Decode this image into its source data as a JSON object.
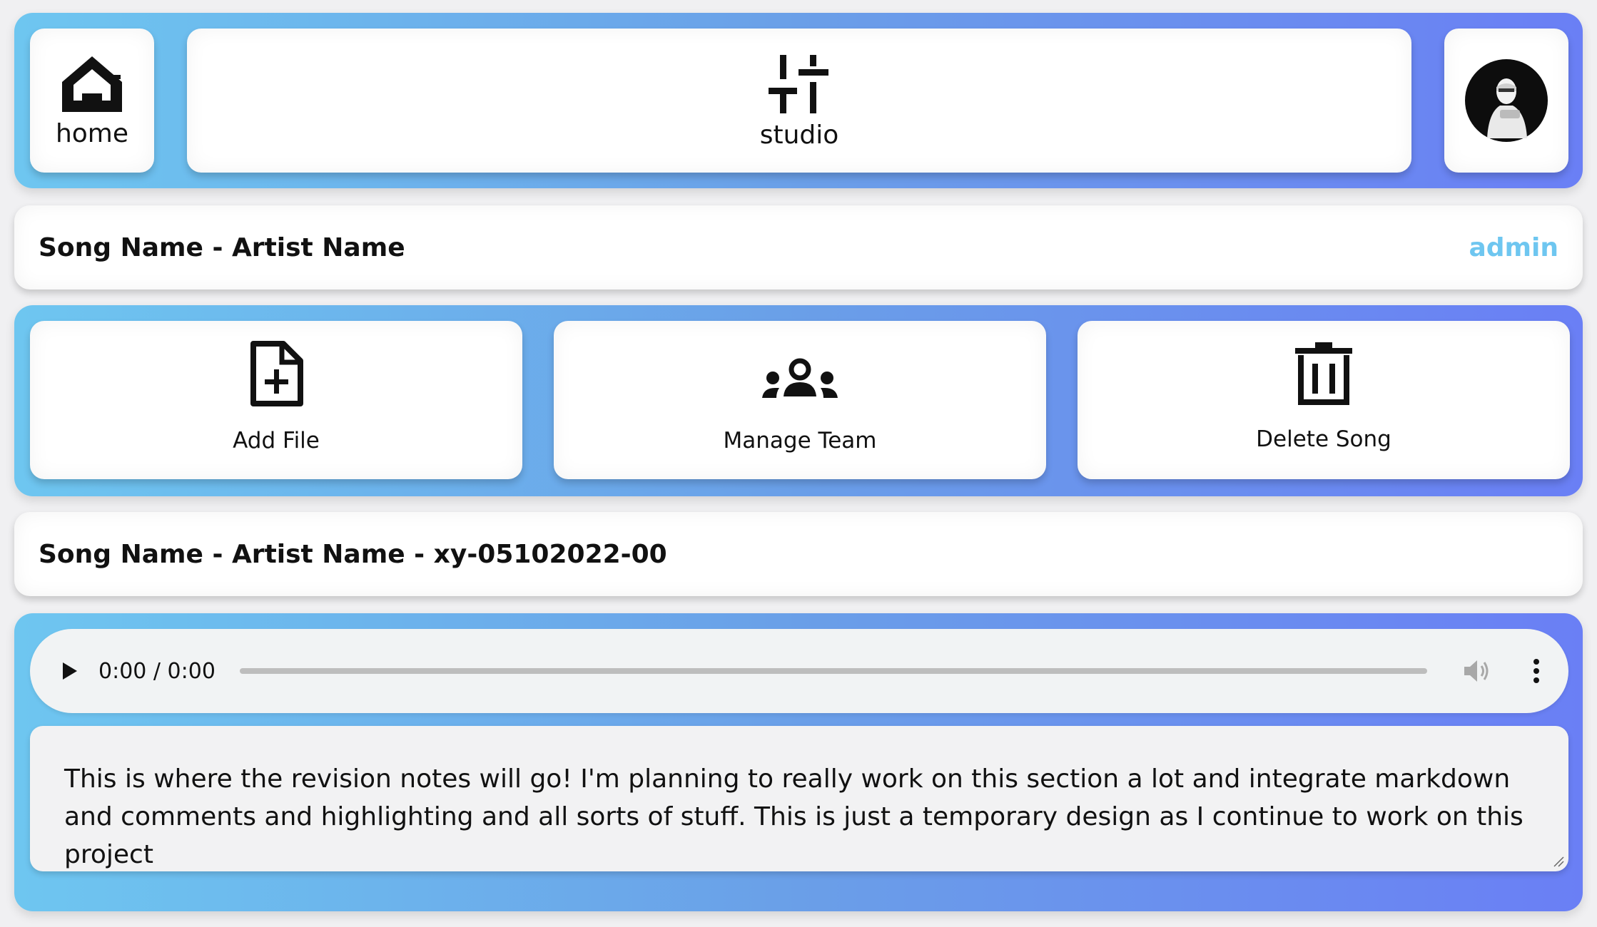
{
  "nav": {
    "home_label": "home",
    "studio_label": "studio"
  },
  "song_header": {
    "title": "Song Name - Artist Name",
    "role": "admin"
  },
  "actions": [
    {
      "label": "Add File",
      "icon": "file-plus-icon"
    },
    {
      "label": "Manage Team",
      "icon": "team-icon"
    },
    {
      "label": "Delete Song",
      "icon": "trash-icon"
    }
  ],
  "revision": {
    "title": "Song Name - Artist Name - xy-05102022-00"
  },
  "player": {
    "time": "0:00 / 0:00"
  },
  "notes": {
    "text": "This is where the revision notes will go! I'm planning to really work on this section a lot and integrate markdown and comments and highlighting and all sorts of stuff. This is just a temporary design as I continue to work on this project"
  },
  "colors": {
    "gradient_start": "#6ec6f0",
    "gradient_end": "#6a7ff5",
    "admin_accent": "#6ec6f0"
  }
}
